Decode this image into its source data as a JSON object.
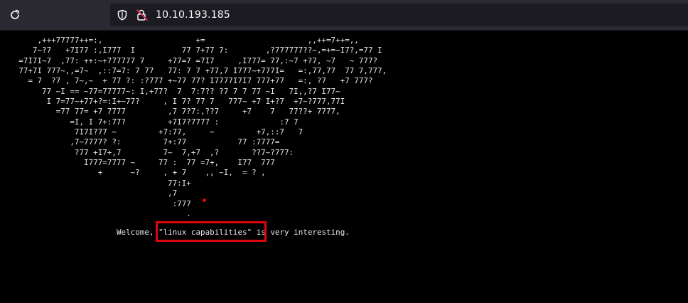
{
  "browser": {
    "url": "10.10.193.185"
  },
  "content": {
    "ascii_art": "        ,+++77777++=:,                    +=                      ,,++=7++=,,\n       7~?7   +7I77 :,I777  I          77 7+77 7:        ,?777777??~,=+=~I7?,=77 I\n    =7I7I~7  ,77: ++:~+777777 7     +77=7 =7I7     ,I777= 77,:~7 +?7, ~7   ~ 777?\n    77+7I 777~,,=7~  ,::7=7: 7 77   77: 7 7 +77,7 I777~+777I=   =:,77,77  77 7,777,\n      = 7  ?7 , 7~,~  + 77 ?: :?777 +~77 77? I7777I7I7 777+77   =:, ?7   +7 777?\n         77 ~I == ~77=77777~: I,+77?  7  7:7?? ?7 7 7 77 ~I   7I,,?7 I77~\n          I 7=77~+77+?=:I+~77?     , I 7? 77 7   777~ +7 I+?7  +7~?777,77I\n            =77 77= +7 7777         ,7 7?7:,??7     +7    7   77??+ 7777,\n               =I, I 7+:77?         +7I7?7777 :             :7 7\n                7I7I?77 ~         +7:77,     ~         +7,::7   7\n               ,7~7777? ?:         7+:77           77 :7777=\n                ?77 +I7+,7         7~  7,+7  ,?       ??7~?777:\n                  I777=7777 ~     77 :  77 =7+,    I77  777\n                     +      ~?     , + 7    ,, ~I,  = ? ,\n                                    77:I+\n                                    ,7\n                                     :777\n                                        .",
    "welcome_text": "Welcome, \"linux capabilities\" is very interesting."
  },
  "colors": {
    "background": "#000000",
    "text": "#e8e8e8",
    "highlight": "#e0060e",
    "toolbar": "#2b2a33",
    "urlbar": "#1c1b22"
  },
  "icons": {
    "reload": "reload-icon",
    "shield": "shield-icon",
    "lock": "insecure-lock-icon"
  }
}
